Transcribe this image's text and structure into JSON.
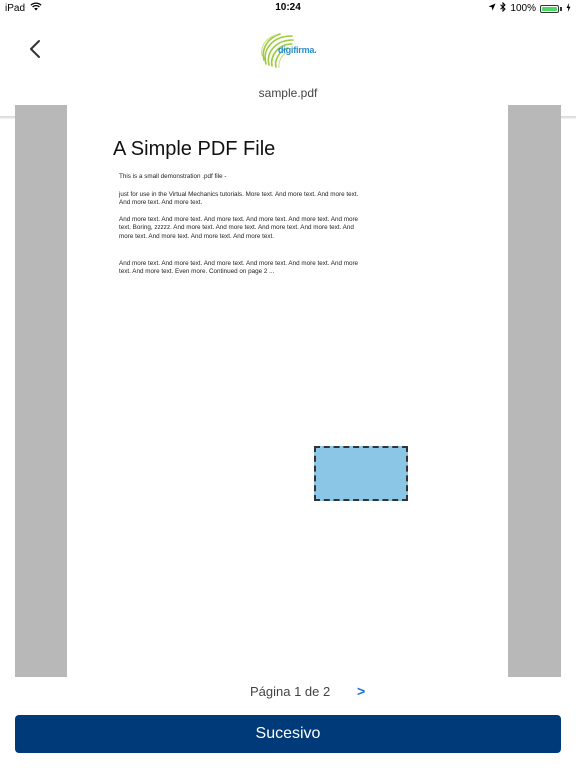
{
  "status_bar": {
    "device": "iPad",
    "time": "10:24",
    "battery_percent": "100%",
    "battery_level": 1.0,
    "icons": [
      "wifi-icon",
      "location-icon",
      "bluetooth-icon",
      "battery-icon",
      "charging-icon"
    ]
  },
  "header": {
    "back_icon": "chevron-left-icon",
    "logo_text": "digifirma.",
    "filename": "sample.pdf"
  },
  "document": {
    "title": "A Simple PDF File",
    "paragraphs": [
      "This is a small demonstration .pdf file -",
      "just for use in the Virtual Mechanics tutorials. More text. And more text. And more text. And more text. And more text.",
      "And more text. And more text. And more text. And more text. And more text. And more text. Boring, zzzzz. And more text. And more text. And more text. And more text. And more text. And more text. And more text. And more text.",
      "And more text. And more text. And more text. And more text. And more text. And more text. And more text. Even more. Continued on page 2 ..."
    ]
  },
  "pagination": {
    "label": "Página 1 de 2",
    "next_label": ">"
  },
  "actions": {
    "primary_label": "Sucesivo"
  },
  "colors": {
    "primary": "#003a78",
    "signature_field": "#8cc6e6",
    "link": "#1f6fd1",
    "viewer_background": "#b8b8b8"
  }
}
